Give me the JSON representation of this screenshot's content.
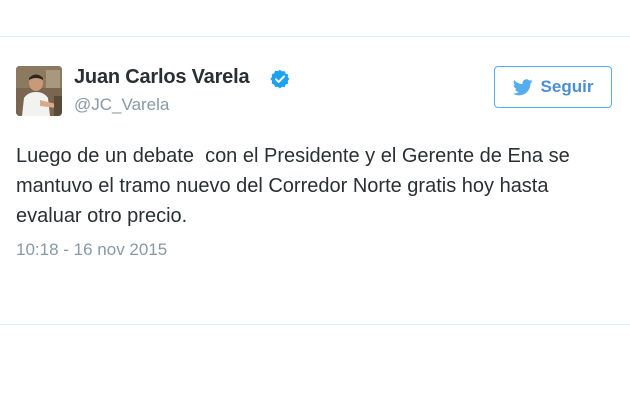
{
  "author": {
    "display_name": "Juan Carlos Varela",
    "screen_name": "@JC_Varela",
    "verified": true
  },
  "follow_button": {
    "label": "Seguir",
    "icon": "twitter-bird-icon"
  },
  "tweet": {
    "text": "Luego de un debate  con el Presidente y el Gerente de Ena se mantuvo el tramo nuevo del Corredor Norte gratis hoy hasta evaluar otro precio.",
    "timestamp": "10:18 - 16 nov 2015"
  },
  "colors": {
    "accent": "#55acee",
    "name_text": "#292f33",
    "secondary_text": "#8899a6",
    "verified": "#1da1f2",
    "divider": "#e6ebef"
  },
  "icons": [
    "avatar-photo",
    "verified-badge-icon",
    "twitter-bird-icon"
  ]
}
